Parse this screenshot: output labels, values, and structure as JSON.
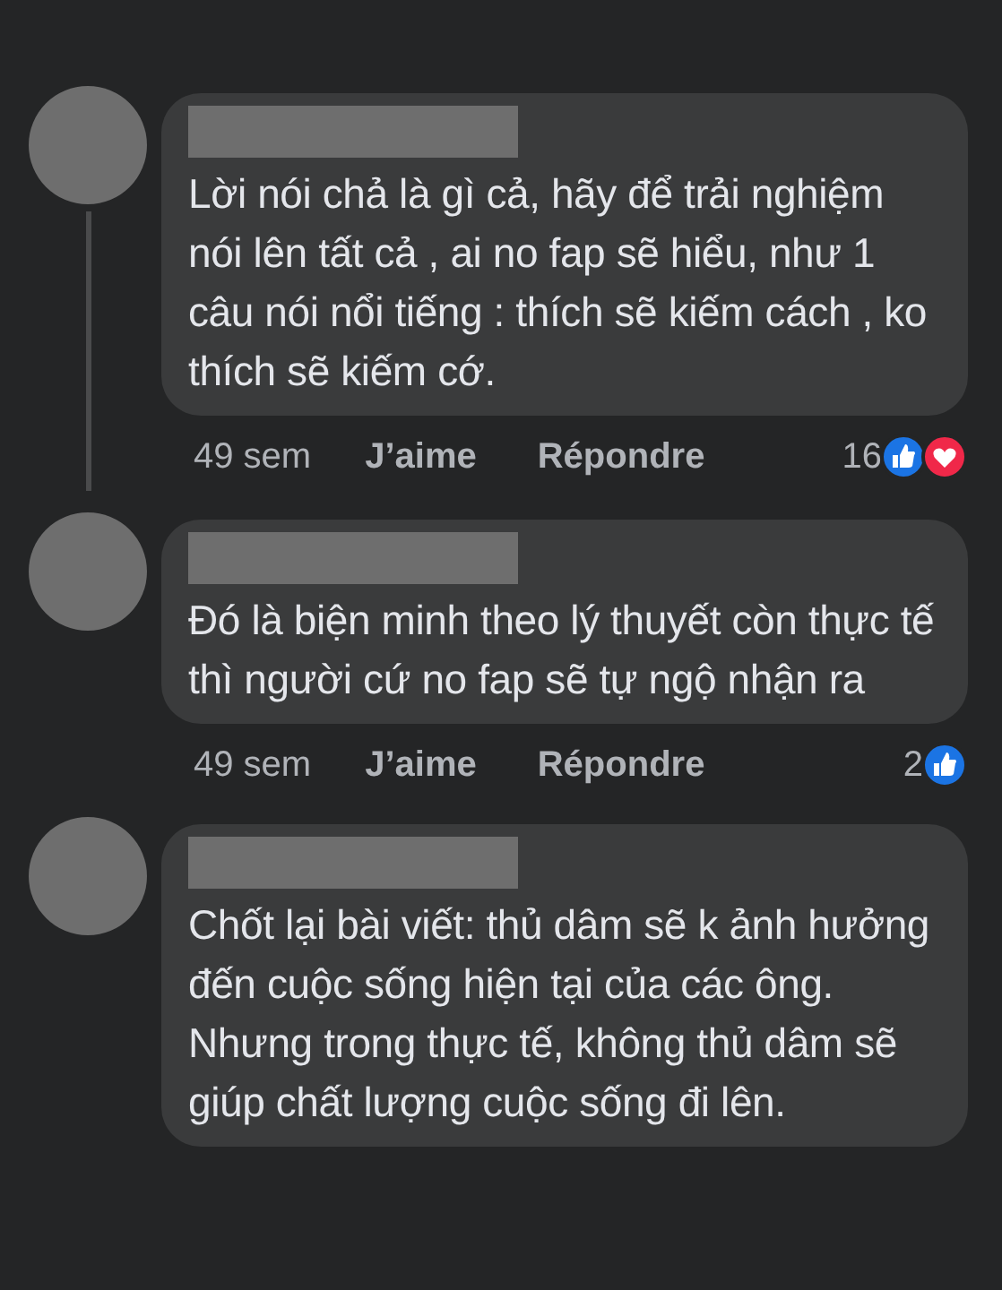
{
  "comments": [
    {
      "text": "Lời nói chả là gì cả, hãy để trải nghiệm nói lên tất cả , ai no fap sẽ hiểu, như 1 câu nói nổi tiếng : thích sẽ kiếm cách , ko thích sẽ kiếm cớ.",
      "thread_line": true,
      "time": "49 sem",
      "like": "J’aime",
      "reply": "Répondre",
      "reaction_count": "16",
      "reactions": [
        {
          "kind": "like"
        },
        {
          "kind": "heart"
        }
      ]
    },
    {
      "text": "Đó là biện minh theo lý thuyết còn thực tế thì người cứ no fap sẽ tự ngộ nhận ra",
      "thread_line": false,
      "time": "49 sem",
      "like": "J’aime",
      "reply": "Répondre",
      "reaction_count": "2",
      "reactions": [
        {
          "kind": "like"
        }
      ]
    },
    {
      "text": "Chốt lại bài viết: thủ dâm sẽ k ảnh hưởng đến cuộc sống hiện tại của các ông. Nhưng trong thực tế, không thủ dâm sẽ giúp chất lượng cuộc sống đi lên.",
      "thread_line": false
    }
  ]
}
